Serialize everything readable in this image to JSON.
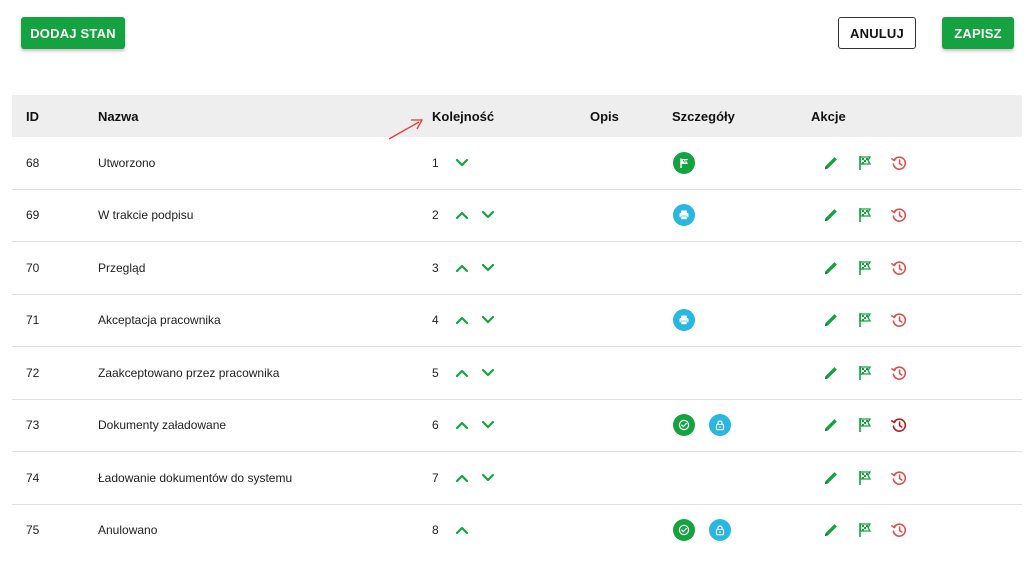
{
  "toolbar": {
    "add_label": "DODAJ STAN",
    "cancel_label": "ANULUJ",
    "save_label": "ZAPISZ"
  },
  "table": {
    "headers": {
      "id": "ID",
      "name": "Nazwa",
      "order": "Kolejność",
      "description": "Opis",
      "details": "Szczegóły",
      "actions": "Akcje"
    },
    "rows": [
      {
        "id": "68",
        "name": "Utworzono",
        "order": "1",
        "up": false,
        "down": true,
        "details": [
          "flag-circle"
        ]
      },
      {
        "id": "69",
        "name": "W trakcie podpisu",
        "order": "2",
        "up": true,
        "down": true,
        "details": [
          "print-circle"
        ]
      },
      {
        "id": "70",
        "name": "Przegląd",
        "order": "3",
        "up": true,
        "down": true,
        "details": []
      },
      {
        "id": "71",
        "name": "Akceptacja pracownika",
        "order": "4",
        "up": true,
        "down": true,
        "details": [
          "print-circle"
        ]
      },
      {
        "id": "72",
        "name": "Zaakceptowano przez pracownika",
        "order": "5",
        "up": true,
        "down": true,
        "details": []
      },
      {
        "id": "73",
        "name": "Dokumenty załadowane",
        "order": "6",
        "up": true,
        "down": true,
        "details": [
          "check-circle",
          "lock-circle"
        ]
      },
      {
        "id": "74",
        "name": "Ładowanie dokumentów do systemu",
        "order": "7",
        "up": true,
        "down": true,
        "details": []
      },
      {
        "id": "75",
        "name": "Anulowano",
        "order": "8",
        "up": true,
        "down": false,
        "details": [
          "check-circle",
          "lock-circle"
        ]
      }
    ],
    "actions": [
      "pencil-icon",
      "finish-flag-icon",
      "history-icon"
    ]
  },
  "colors": {
    "green": "#14a340",
    "cyan": "#29b6e0",
    "red": "#d9534f",
    "dark_red": "#b71c1c",
    "header_bg": "#eeeeee",
    "annotation": "#e53935"
  }
}
